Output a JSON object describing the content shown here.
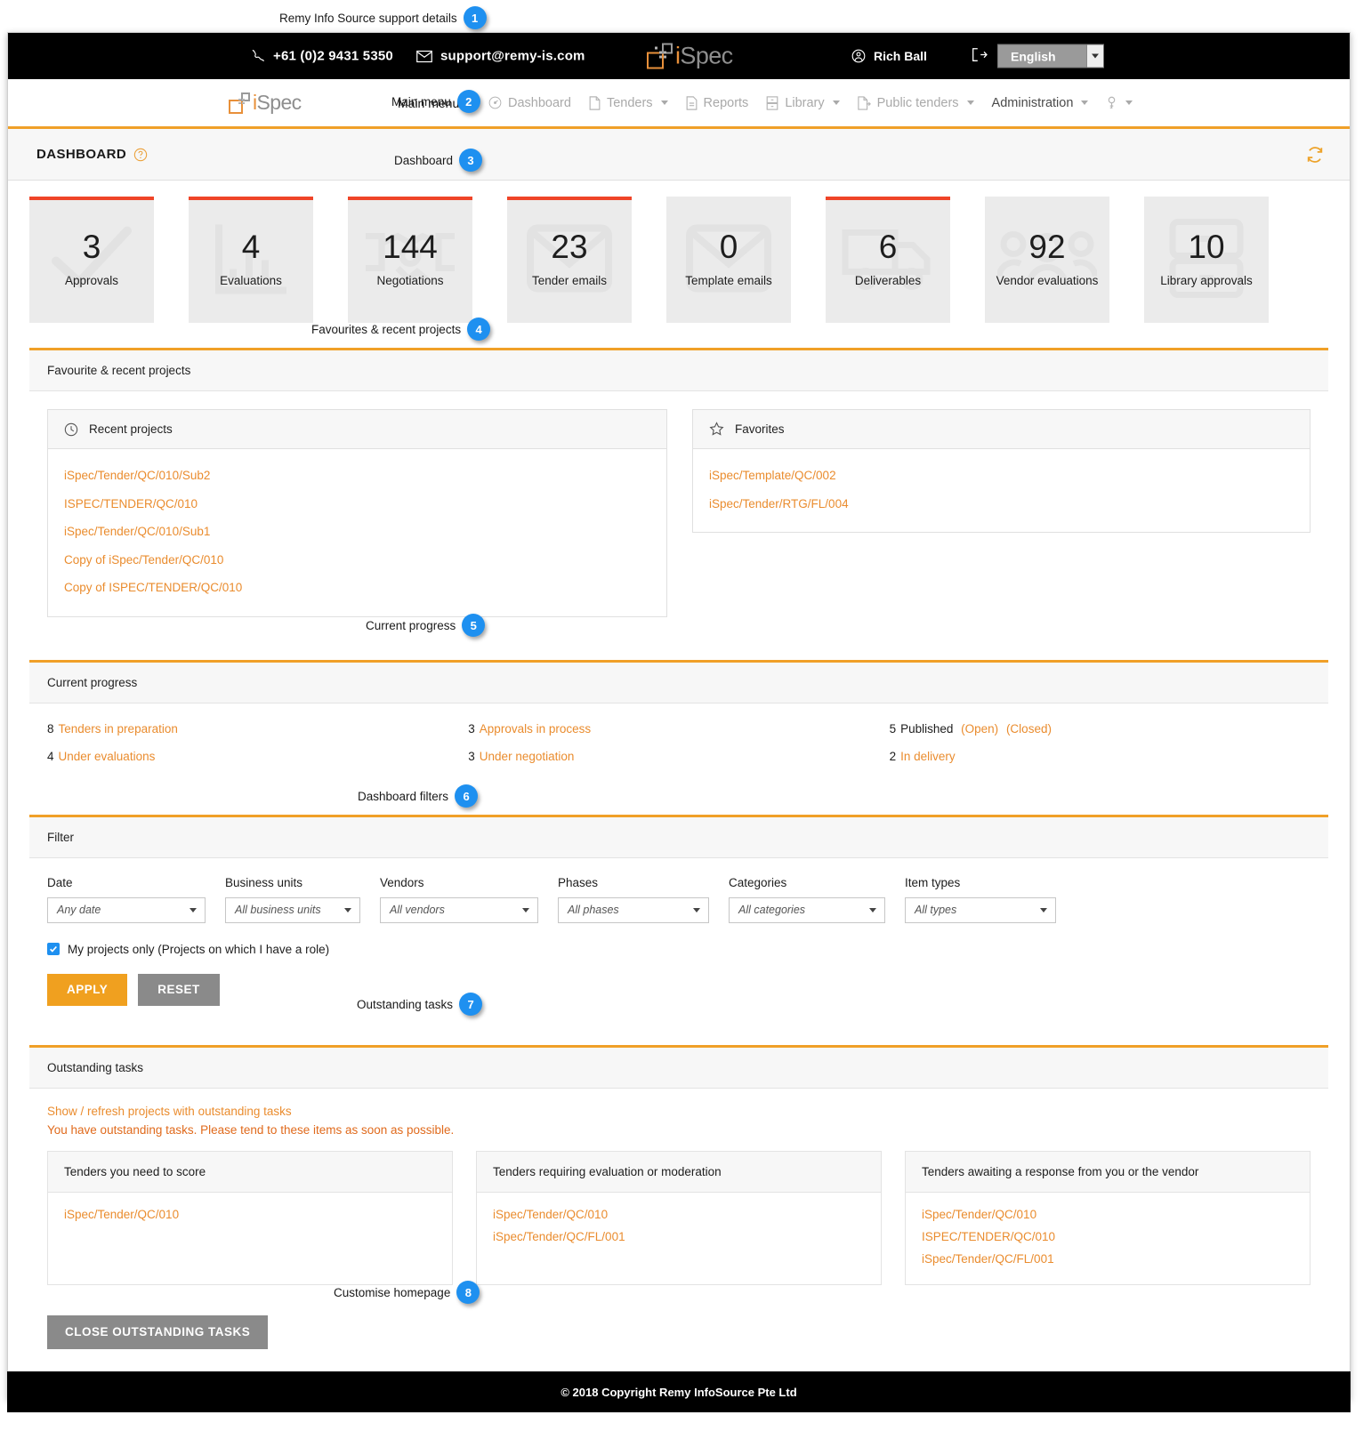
{
  "callouts": [
    {
      "n": "1",
      "text": "Remy Info Source support details"
    },
    {
      "n": "2",
      "text": "Main menu"
    },
    {
      "n": "3",
      "text": "Dashboard"
    },
    {
      "n": "4",
      "text": "Favourites & recent projects"
    },
    {
      "n": "5",
      "text": "Current progress"
    },
    {
      "n": "6",
      "text": "Dashboard filters"
    },
    {
      "n": "7",
      "text": "Outstanding tasks"
    },
    {
      "n": "8",
      "text": "Customise homepage"
    }
  ],
  "topbar": {
    "phone": "+61 (0)2 9431 5350",
    "phone_icon": "phone-icon",
    "email": "support@remy-is.com",
    "email_icon": "envelope-icon",
    "logo_i": "i",
    "logo_spec": "Spec",
    "user_name": "Rich Ball",
    "user_icon": "user-circle-icon",
    "logout_icon": "logout-icon",
    "language": "English"
  },
  "menubar": {
    "main_menu_label": "Main menu",
    "items": [
      {
        "label": "Dashboard",
        "icon": "gauge-icon",
        "caret": false
      },
      {
        "label": "Tenders",
        "icon": "document-icon",
        "caret": true
      },
      {
        "label": "Reports",
        "icon": "report-icon",
        "caret": false
      },
      {
        "label": "Library",
        "icon": "drawer-icon",
        "caret": true
      },
      {
        "label": "Public tenders",
        "icon": "document-arrow-icon",
        "caret": true
      },
      {
        "label": "Administration",
        "icon": "",
        "caret": true
      },
      {
        "label": "",
        "icon": "key-icon",
        "caret": true
      }
    ]
  },
  "pagetitle": {
    "title": "DASHBOARD",
    "help_icon": "question-circle-icon",
    "refresh_icon": "refresh-icon"
  },
  "cards": [
    {
      "value": "3",
      "label": "Approvals",
      "alert": true,
      "icon": "check-icon"
    },
    {
      "value": "4",
      "label": "Evaluations",
      "alert": true,
      "icon": "bar-chart-icon"
    },
    {
      "value": "144",
      "label": "Negotiations",
      "alert": true,
      "icon": "handshake-icon"
    },
    {
      "value": "23",
      "label": "Tender emails",
      "alert": true,
      "icon": "envelope-icon"
    },
    {
      "value": "0",
      "label": "Template emails",
      "alert": false,
      "icon": "envelope-icon"
    },
    {
      "value": "6",
      "label": "Deliverables",
      "alert": true,
      "icon": "truck-icon"
    },
    {
      "value": "92",
      "label": "Vendor evaluations",
      "alert": false,
      "icon": "people-icon"
    },
    {
      "value": "10",
      "label": "Library approvals",
      "alert": false,
      "icon": "library-icon"
    }
  ],
  "favourites": {
    "panel_title": "Favourite & recent projects",
    "recent": {
      "title": "Recent projects",
      "icon": "clock-icon",
      "items": [
        "iSpec/Tender/QC/010/Sub2",
        "ISPEC/TENDER/QC/010",
        "iSpec/Tender/QC/010/Sub1",
        "Copy of iSpec/Tender/QC/010",
        "Copy of ISPEC/TENDER/QC/010"
      ]
    },
    "favorites": {
      "title": "Favorites",
      "icon": "star-icon",
      "items": [
        "iSpec/Template/QC/002",
        "iSpec/Tender/RTG/FL/004"
      ]
    }
  },
  "progress": {
    "panel_title": "Current progress",
    "col1": [
      {
        "count": "8",
        "label": "Tenders in preparation"
      },
      {
        "count": "4",
        "label": "Under evaluations"
      }
    ],
    "col2": [
      {
        "count": "3",
        "label": "Approvals in process"
      },
      {
        "count": "3",
        "label": "Under negotiation"
      }
    ],
    "col3": [
      {
        "count": "5",
        "plain": "Published",
        "links": [
          "(Open)",
          "(Closed)"
        ]
      },
      {
        "count": "2",
        "label": "In delivery"
      }
    ]
  },
  "filter": {
    "panel_title": "Filter",
    "fields": [
      {
        "label": "Date",
        "value": "Any date"
      },
      {
        "label": "Business units",
        "value": "All business units"
      },
      {
        "label": "Vendors",
        "value": "All vendors"
      },
      {
        "label": "Phases",
        "value": "All phases"
      },
      {
        "label": "Categories",
        "value": "All categories"
      },
      {
        "label": "Item types",
        "value": "All types"
      }
    ],
    "checkbox_label": "My projects only (Projects on which I have a role)",
    "checkbox_checked": true,
    "apply_label": "APPLY",
    "reset_label": "RESET"
  },
  "outstanding": {
    "panel_title": "Outstanding tasks",
    "show_link": "Show / refresh projects with outstanding tasks",
    "note": "You have outstanding tasks. Please tend to these items as soon as possible.",
    "columns": [
      {
        "title": "Tenders you need to score",
        "items": [
          "iSpec/Tender/QC/010"
        ]
      },
      {
        "title": "Tenders requiring evaluation or moderation",
        "items": [
          "iSpec/Tender/QC/010",
          "iSpec/Tender/QC/FL/001"
        ]
      },
      {
        "title": "Tenders awaiting a response from you or the vendor",
        "items": [
          "iSpec/Tender/QC/010",
          "ISPEC/TENDER/QC/010",
          "iSpec/Tender/QC/FL/001"
        ]
      }
    ],
    "close_button": "CLOSE OUTSTANDING TASKS"
  },
  "customise_link": "Customise homepage",
  "footer": "© 2018 Copyright  Remy InfoSource Pte Ltd",
  "colors": {
    "orange": "#f0a028",
    "link_orange": "#ea8c2e",
    "alert_red": "#ef4428",
    "badge_blue": "#1e90f0",
    "card_bg": "#ebebeb"
  }
}
